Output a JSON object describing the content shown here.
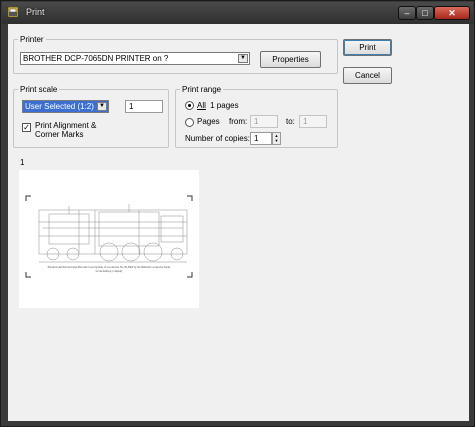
{
  "window": {
    "title": "Print"
  },
  "printer": {
    "group_label": "Printer",
    "selected": "BROTHER DCP-7065DN PRINTER on ?",
    "properties_label": "Properties"
  },
  "actions": {
    "print_label": "Print",
    "cancel_label": "Cancel"
  },
  "print_scale": {
    "group_label": "Print scale",
    "selected": "User Selected (1:2)",
    "value": "1",
    "alignment_checked": true,
    "alignment_label_line1": "Print Alignment &",
    "alignment_label_line2": "Corner Marks"
  },
  "print_range": {
    "group_label": "Print range",
    "all_label": "All",
    "all_pages_text": "1 pages",
    "pages_label": "Pages",
    "from_label": "from:",
    "from_value": "1",
    "to_label": "to:",
    "to_value": "1",
    "copies_label": "Number of copies:",
    "copies_value": "1",
    "selected": "all"
  },
  "preview": {
    "page_number": "1",
    "caption_line1": "Elevation and Part-Sectional Plan and Cross-Sections of Locomotive No. 99, Built by the Baldwin Locomotive Works",
    "caption_line2": "for the Railway Company"
  },
  "colors": {
    "selection": "#3c6fd1",
    "close_button": "#c0392b"
  }
}
